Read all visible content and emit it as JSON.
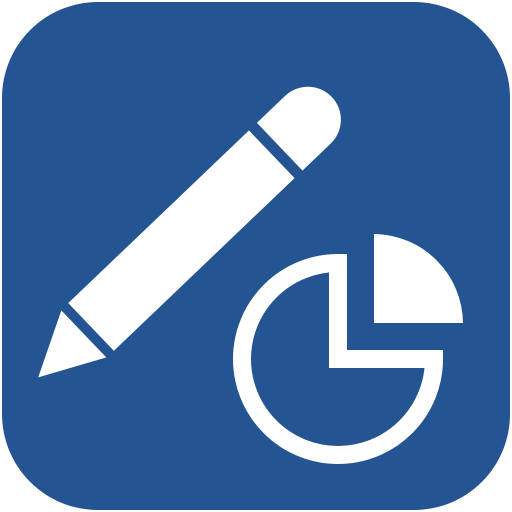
{
  "icon": {
    "name": "pencil-and-pie-chart-app-icon",
    "background_color": "#245592",
    "glyph_color": "#ffffff",
    "glyphs": [
      "pencil-icon",
      "pie-chart-icon"
    ]
  }
}
